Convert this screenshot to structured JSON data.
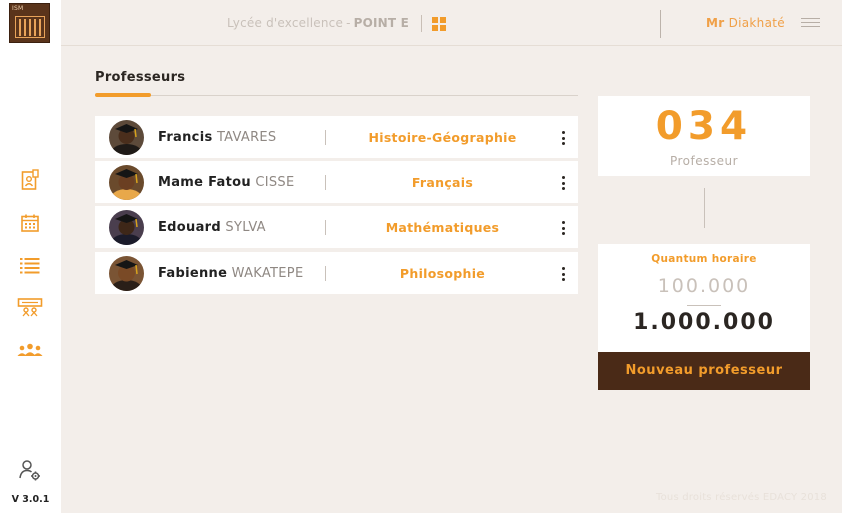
{
  "app": {
    "logo_text": "ISM",
    "version": "V 3.0.1",
    "school_name": "Lycée d'excellence",
    "school_separator": "-",
    "site_name": "POINT E"
  },
  "user": {
    "title": "Mr",
    "name": "Diakhaté"
  },
  "sidebar": {
    "items": [
      {
        "icon": "profile-card-icon"
      },
      {
        "icon": "calendar-icon"
      },
      {
        "icon": "list-icon"
      },
      {
        "icon": "classroom-icon"
      },
      {
        "icon": "users-icon"
      }
    ],
    "bottom_icon": "user-settings-icon"
  },
  "section": {
    "title": "Professeurs"
  },
  "professors": [
    {
      "first_name": "Francis",
      "last_name": "TAVARES",
      "subject": "Histoire-Géographie"
    },
    {
      "first_name": "Mame Fatou",
      "last_name": "CISSE",
      "subject": "Français"
    },
    {
      "first_name": "Edouard",
      "last_name": "SYLVA",
      "subject": "Mathématiques"
    },
    {
      "first_name": "Fabienne",
      "last_name": "WAKATEPE",
      "subject": "Philosophie"
    }
  ],
  "stats": {
    "count": "034",
    "count_label": "Professeur",
    "quota_label": "Quantum horaire",
    "quota_used": "100.000",
    "quota_total": "1.000.000"
  },
  "actions": {
    "new_professor": "Nouveau professeur"
  },
  "footer": {
    "text": "Tous droits réservés EDACY 2018"
  },
  "colors": {
    "accent": "#f29c2b",
    "brand_dark": "#4a2a17",
    "background": "#f3eeea"
  }
}
